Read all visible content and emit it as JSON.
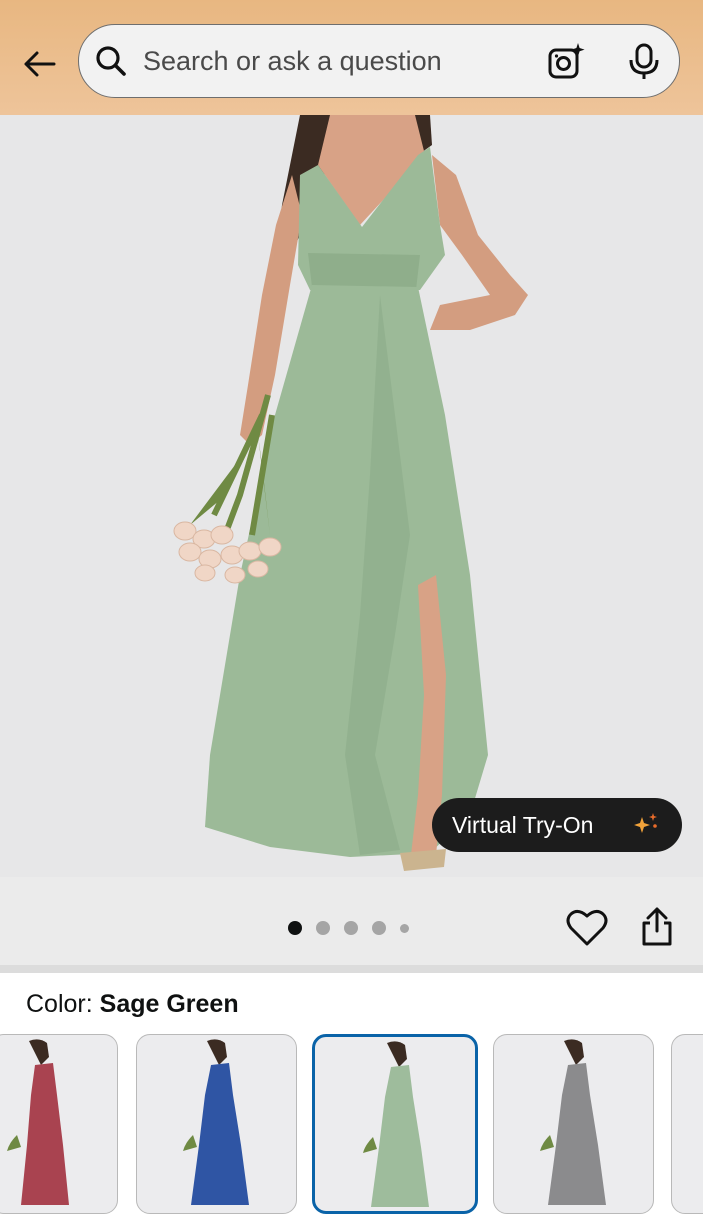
{
  "search": {
    "placeholder": "Search or ask a question",
    "value": ""
  },
  "product": {
    "image_count": 5,
    "active_image": 1,
    "virtual_try_on_label": "Virtual Try-On"
  },
  "color": {
    "label": "Color: ",
    "selected": "Sage Green",
    "swatch_colors": [
      "#a94350",
      "#2f55a4",
      "#9ebc9c",
      "#8b8b8d"
    ]
  },
  "colors": {
    "header_bg": "#e9b883",
    "selected_border": "#0a63a8",
    "dress": "#9cba98"
  }
}
